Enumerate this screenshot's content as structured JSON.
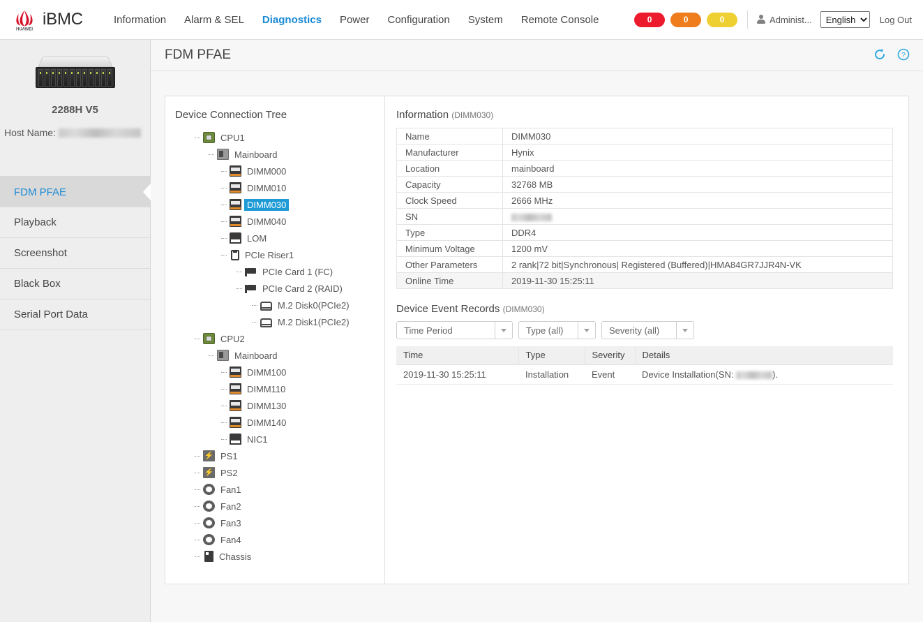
{
  "header": {
    "brand": "iBMC",
    "logo_icon": "huawei-logo",
    "nav": [
      {
        "label": "Information",
        "active": false
      },
      {
        "label": "Alarm & SEL",
        "active": false
      },
      {
        "label": "Diagnostics",
        "active": true
      },
      {
        "label": "Power",
        "active": false
      },
      {
        "label": "Configuration",
        "active": false
      },
      {
        "label": "System",
        "active": false
      },
      {
        "label": "Remote Console",
        "active": false
      }
    ],
    "badges": [
      {
        "name": "critical-alarm-badge",
        "count": "0",
        "color": "#ED1B2E"
      },
      {
        "name": "major-alarm-badge",
        "count": "0",
        "color": "#F07D1D"
      },
      {
        "name": "minor-alarm-badge",
        "count": "0",
        "color": "#EFD033"
      }
    ],
    "user_icon": "user-icon",
    "username": "Administ...",
    "language": "English",
    "language_options": [
      "English"
    ],
    "logout": "Log Out"
  },
  "sidebar": {
    "model": "2288H V5",
    "hostname_label": "Host Name:",
    "hostname_value": "",
    "items": [
      {
        "label": "FDM PFAE",
        "active": true
      },
      {
        "label": "Playback",
        "active": false
      },
      {
        "label": "Screenshot",
        "active": false
      },
      {
        "label": "Black Box",
        "active": false
      },
      {
        "label": "Serial Port Data",
        "active": false
      }
    ]
  },
  "page": {
    "title": "FDM PFAE",
    "refresh_icon": "refresh-icon",
    "help_icon": "help-icon",
    "accent_color": "#1a8ad4"
  },
  "tree": {
    "title": "Device Connection Tree",
    "selected": "DIMM030",
    "nodes": [
      {
        "label": "CPU1",
        "icon": "cpu-icon",
        "depth": 1
      },
      {
        "label": "Mainboard",
        "icon": "mainboard-icon",
        "depth": 2
      },
      {
        "label": "DIMM000",
        "icon": "dimm-icon",
        "depth": 3
      },
      {
        "label": "DIMM010",
        "icon": "dimm-icon",
        "depth": 3
      },
      {
        "label": "DIMM030",
        "icon": "dimm-icon",
        "depth": 3,
        "selected": true
      },
      {
        "label": "DIMM040",
        "icon": "dimm-icon",
        "depth": 3
      },
      {
        "label": "LOM",
        "icon": "lom-icon",
        "depth": 3
      },
      {
        "label": "PCIe Riser1",
        "icon": "riser-icon",
        "depth": 3
      },
      {
        "label": "PCIe Card 1 (FC)",
        "icon": "pcie-card-icon",
        "depth": 4
      },
      {
        "label": "PCIe Card 2 (RAID)",
        "icon": "pcie-card-icon",
        "depth": 4
      },
      {
        "label": "M.2 Disk0(PCIe2)",
        "icon": "disk-icon",
        "depth": 5
      },
      {
        "label": "M.2 Disk1(PCIe2)",
        "icon": "disk-icon",
        "depth": 5
      },
      {
        "label": "CPU2",
        "icon": "cpu-icon",
        "depth": 1
      },
      {
        "label": "Mainboard",
        "icon": "mainboard-icon",
        "depth": 2
      },
      {
        "label": "DIMM100",
        "icon": "dimm-icon",
        "depth": 3
      },
      {
        "label": "DIMM110",
        "icon": "dimm-icon",
        "depth": 3
      },
      {
        "label": "DIMM130",
        "icon": "dimm-icon",
        "depth": 3
      },
      {
        "label": "DIMM140",
        "icon": "dimm-icon",
        "depth": 3
      },
      {
        "label": "NIC1",
        "icon": "nic-icon",
        "depth": 3
      },
      {
        "label": "PS1",
        "icon": "power-supply-icon",
        "depth": 1
      },
      {
        "label": "PS2",
        "icon": "power-supply-icon",
        "depth": 1
      },
      {
        "label": "Fan1",
        "icon": "fan-icon",
        "depth": 1
      },
      {
        "label": "Fan2",
        "icon": "fan-icon",
        "depth": 1
      },
      {
        "label": "Fan3",
        "icon": "fan-icon",
        "depth": 1
      },
      {
        "label": "Fan4",
        "icon": "fan-icon",
        "depth": 1
      },
      {
        "label": "Chassis",
        "icon": "chassis-icon",
        "depth": 1
      }
    ]
  },
  "information": {
    "title": "Information",
    "subject": "(DIMM030)",
    "rows": [
      {
        "key": "Name",
        "value": "DIMM030"
      },
      {
        "key": "Manufacturer",
        "value": "Hynix"
      },
      {
        "key": "Location",
        "value": "mainboard"
      },
      {
        "key": "Capacity",
        "value": "32768 MB"
      },
      {
        "key": "Clock Speed",
        "value": "2666 MHz"
      },
      {
        "key": "SN",
        "value": "",
        "redacted": true
      },
      {
        "key": "Type",
        "value": "DDR4"
      },
      {
        "key": "Minimum Voltage",
        "value": "1200 mV"
      },
      {
        "key": "Other Parameters",
        "value": "2 rank|72 bit|Synchronous| Registered (Buffered)|HMA84GR7JJR4N-VK"
      },
      {
        "key": "Online Time",
        "value": "2019-11-30 15:25:11",
        "shaded": true
      }
    ]
  },
  "events": {
    "title": "Device Event Records",
    "subject": "(DIMM030)",
    "filters": [
      {
        "name": "time-period-filter",
        "label": "Time Period"
      },
      {
        "name": "type-filter",
        "label": "Type (all)"
      },
      {
        "name": "severity-filter",
        "label": "Severity (all)"
      }
    ],
    "columns": [
      "Time",
      "Type",
      "Severity",
      "Details"
    ],
    "rows": [
      {
        "time": "2019-11-30 15:25:11",
        "type": "Installation",
        "severity": "Event",
        "details_prefix": "Device Installation(SN:",
        "details_suffix": ")."
      }
    ]
  }
}
